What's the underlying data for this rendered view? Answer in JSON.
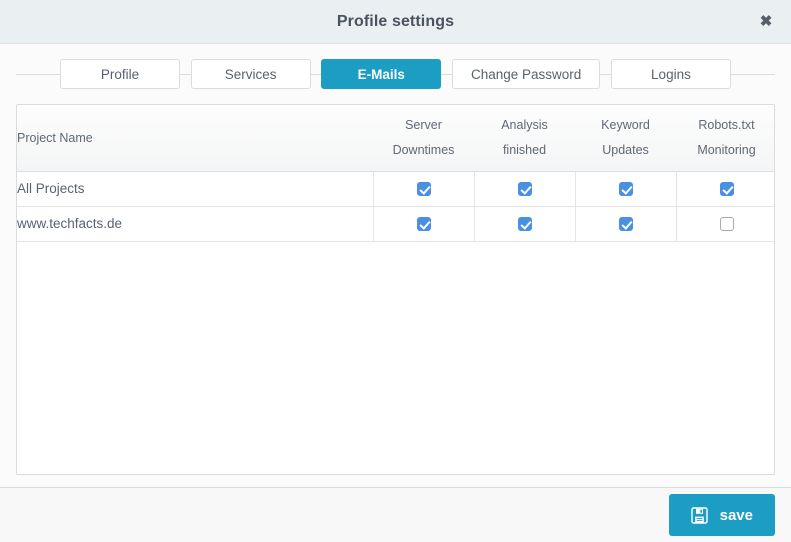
{
  "window": {
    "title": "Profile settings",
    "close_label": "✖",
    "close_icon": "close-icon"
  },
  "tabs": [
    {
      "label": "Profile",
      "active": false
    },
    {
      "label": "Services",
      "active": false
    },
    {
      "label": "E-Mails",
      "active": true
    },
    {
      "label": "Change Password",
      "active": false
    },
    {
      "label": "Logins",
      "active": false
    }
  ],
  "table": {
    "columns": [
      {
        "line1": "Project Name",
        "line2": ""
      },
      {
        "line1": "Server",
        "line2": "Downtimes"
      },
      {
        "line1": "Analysis",
        "line2": "finished"
      },
      {
        "line1": "Keyword",
        "line2": "Updates"
      },
      {
        "line1": "Robots.txt",
        "line2": "Monitoring"
      }
    ],
    "rows": [
      {
        "project": "All Projects",
        "server_downtimes": true,
        "analysis_finished": true,
        "keyword_updates": true,
        "robots_monitoring": true
      },
      {
        "project": "www.techfacts.de",
        "server_downtimes": true,
        "analysis_finished": true,
        "keyword_updates": true,
        "robots_monitoring": false
      }
    ]
  },
  "footer": {
    "save_label": "save",
    "save_icon": "floppy-disk-icon"
  },
  "colors": {
    "accent": "#1c9dc4",
    "checkbox_checked": "#4a90e2",
    "titlebar_bg": "#eaeff2",
    "text": "#5a6270",
    "border": "#dcdcdc"
  }
}
